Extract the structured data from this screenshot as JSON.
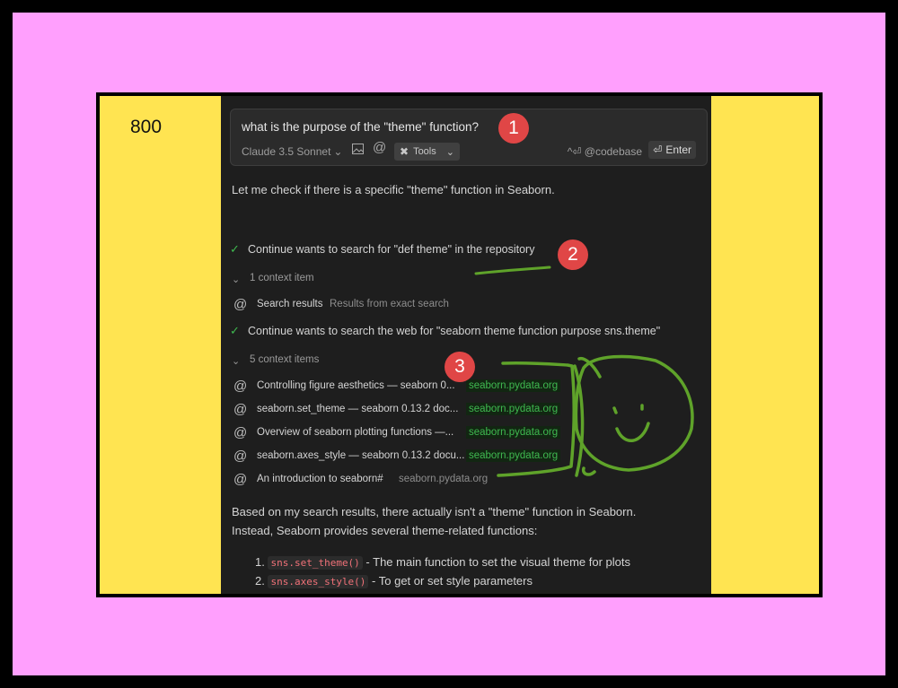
{
  "side_label": "800",
  "input": {
    "prompt": "what is the purpose of the \"theme\" function?",
    "model": "Claude 3.5 Sonnet",
    "tools_label": "Tools",
    "codebase_hint": "^⏎ @codebase",
    "enter_label": "Enter"
  },
  "response": {
    "intro": "Let me check if there is a specific \"theme\" function in Seaborn.",
    "step1": "Continue wants to search for \"def theme\" in the repository",
    "step1_context": "1 context item",
    "step1_items": [
      {
        "title": "Search results",
        "source": "Results from exact search"
      }
    ],
    "step2": "Continue wants to search the web for \"seaborn theme function purpose sns.theme\"",
    "step2_context": "5 context items",
    "step2_items": [
      {
        "title": "Controlling figure aesthetics — seaborn 0...",
        "source": "seaborn.pydata.org"
      },
      {
        "title": "seaborn.set_theme — seaborn 0.13.2 doc...",
        "source": "seaborn.pydata.org"
      },
      {
        "title": "Overview of seaborn plotting functions —...",
        "source": "seaborn.pydata.org"
      },
      {
        "title": "seaborn.axes_style — seaborn 0.13.2 docu...",
        "source": "seaborn.pydata.org"
      },
      {
        "title": "An introduction to seaborn#",
        "source": "seaborn.pydata.org"
      }
    ],
    "conclusion_line1": "Based on my search results, there actually isn't a \"theme\" function in Seaborn.",
    "conclusion_line2": "Instead, Seaborn provides several theme-related functions:",
    "list": [
      {
        "num": "1.",
        "code": "sns.set_theme()",
        "text": " - The main function to set the visual theme for plots"
      },
      {
        "num": "2.",
        "code": "sns.axes_style()",
        "text": " - To get or set style parameters"
      }
    ]
  },
  "annotations": {
    "badge1": "1",
    "badge2": "2",
    "badge3": "3"
  },
  "colors": {
    "pink": "#ff9ffd",
    "yellow": "#ffe451",
    "panel": "#1e1e1e",
    "check_green": "#3fb950",
    "badge_red": "#e04646",
    "drawing_green": "#5fa32a"
  }
}
